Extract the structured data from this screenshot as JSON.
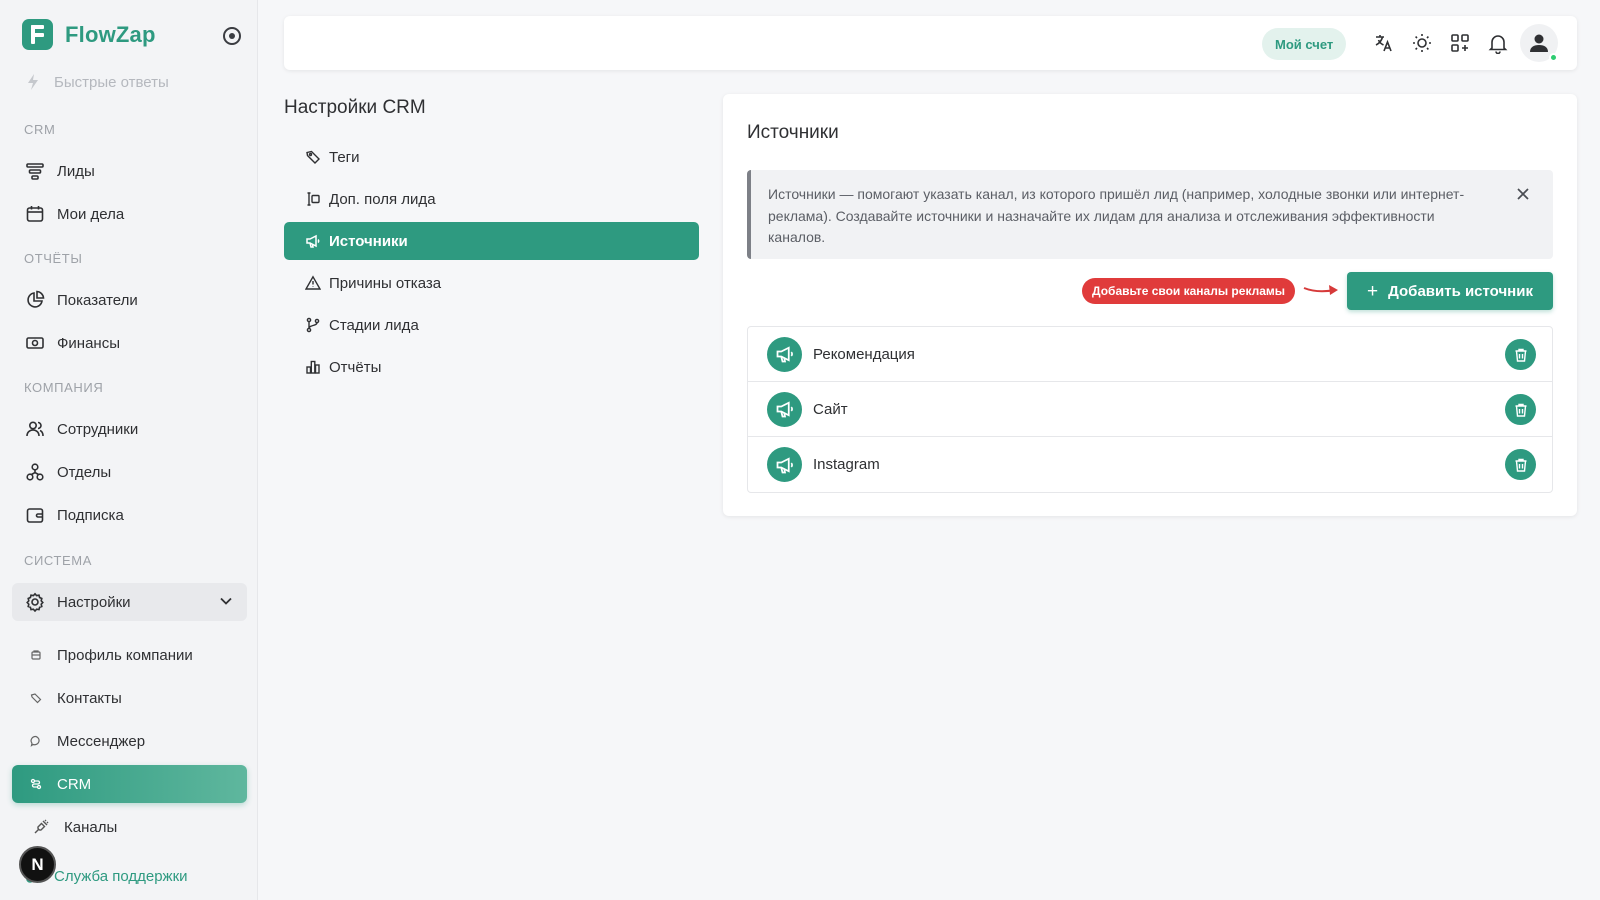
{
  "brand": {
    "name": "FlowZap"
  },
  "sidebar": {
    "faded_item": "Быстрые ответы",
    "sections": {
      "crm": "CRM",
      "reports": "ОТЧЁТЫ",
      "company": "КОМПАНИЯ",
      "system": "СИСТЕМА"
    },
    "items": {
      "leads": "Лиды",
      "tasks": "Мои дела",
      "metrics": "Показатели",
      "finance": "Финансы",
      "employees": "Сотрудники",
      "departments": "Отделы",
      "subscription": "Подписка",
      "settings": "Настройки"
    },
    "settings_sub": {
      "company_profile": "Профиль компании",
      "contacts": "Контакты",
      "messenger": "Мессенджер",
      "crm": "CRM",
      "channels": "Каналы"
    },
    "support": "Служба поддержки",
    "n_badge": "N"
  },
  "topbar": {
    "account": "Мой счет"
  },
  "settings_menu": {
    "title": "Настройки CRM",
    "items": {
      "tags": "Теги",
      "extra_fields": "Доп. поля лида",
      "sources": "Источники",
      "reject_reasons": "Причины отказа",
      "stages": "Стадии лида",
      "reports": "Отчёты"
    }
  },
  "panel": {
    "title": "Источники",
    "info": "Источники — помогают указать канал, из которого пришёл лид (например, холодные звонки или интернет-реклама). Создавайте источники и назначайте их лидам для анализа и отслеживания эффективности каналов.",
    "hint": "Добавьте свои каналы рекламы",
    "add_button": "Добавить источник",
    "sources": [
      "Рекомендация",
      "Сайт",
      "Instagram"
    ]
  },
  "colors": {
    "accent": "#2e9a80",
    "hint": "#e03b3b"
  }
}
